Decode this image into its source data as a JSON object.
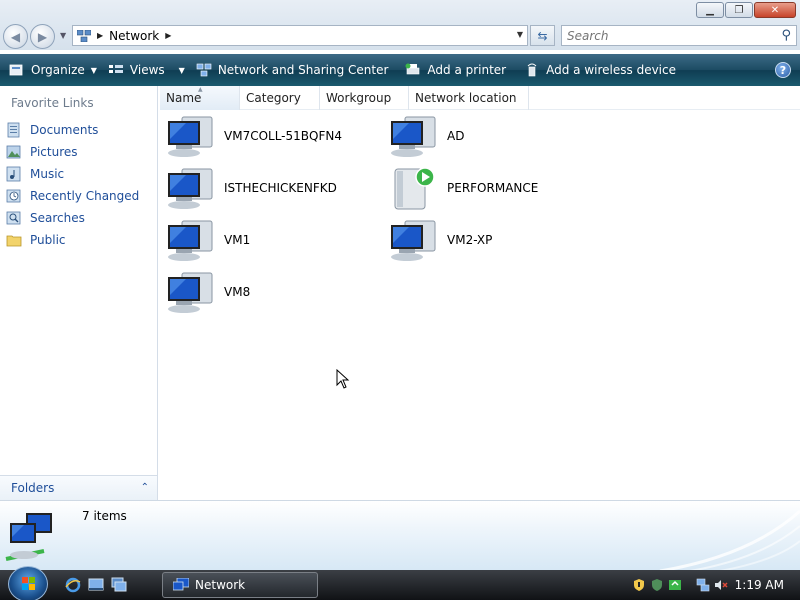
{
  "window": {
    "title": "Network"
  },
  "address": {
    "crumbs": [
      "Network"
    ]
  },
  "search": {
    "placeholder": "Search"
  },
  "commands": [
    {
      "label": "Organize",
      "icon": "organize-icon",
      "dropdown": true
    },
    {
      "label": "Views",
      "icon": "views-icon",
      "dropdown": true
    },
    {
      "label": "Network and Sharing Center",
      "icon": "network-sharing-icon"
    },
    {
      "label": "Add a printer",
      "icon": "add-printer-icon"
    },
    {
      "label": "Add a wireless device",
      "icon": "wireless-device-icon"
    }
  ],
  "nav": {
    "favorites_title": "Favorite Links",
    "links": [
      {
        "label": "Documents",
        "icon": "documents-icon"
      },
      {
        "label": "Pictures",
        "icon": "pictures-icon"
      },
      {
        "label": "Music",
        "icon": "music-icon"
      },
      {
        "label": "Recently Changed",
        "icon": "recently-changed-icon"
      },
      {
        "label": "Searches",
        "icon": "searches-icon"
      },
      {
        "label": "Public",
        "icon": "public-folder-icon"
      }
    ],
    "folders_label": "Folders"
  },
  "columns": [
    "Name",
    "Category",
    "Workgroup",
    "Network location"
  ],
  "items": [
    {
      "name": "VM7COLL-51BQFN4",
      "icon": "computer-icon"
    },
    {
      "name": "AD",
      "icon": "computer-icon"
    },
    {
      "name": "ISTHECHICKENFKD",
      "icon": "computer-icon"
    },
    {
      "name": "PERFORMANCE",
      "icon": "media-device-icon"
    },
    {
      "name": "VM1",
      "icon": "computer-icon"
    },
    {
      "name": "VM2-XP",
      "icon": "computer-icon"
    },
    {
      "name": "VM8",
      "icon": "computer-icon"
    }
  ],
  "details": {
    "count": "7 items"
  },
  "taskbar": {
    "active_window": "Network",
    "clock": "1:19 AM"
  },
  "colors": {
    "command_bar": "#1c4b63",
    "link": "#1f4e99",
    "taskbar": "#1a1d21"
  }
}
